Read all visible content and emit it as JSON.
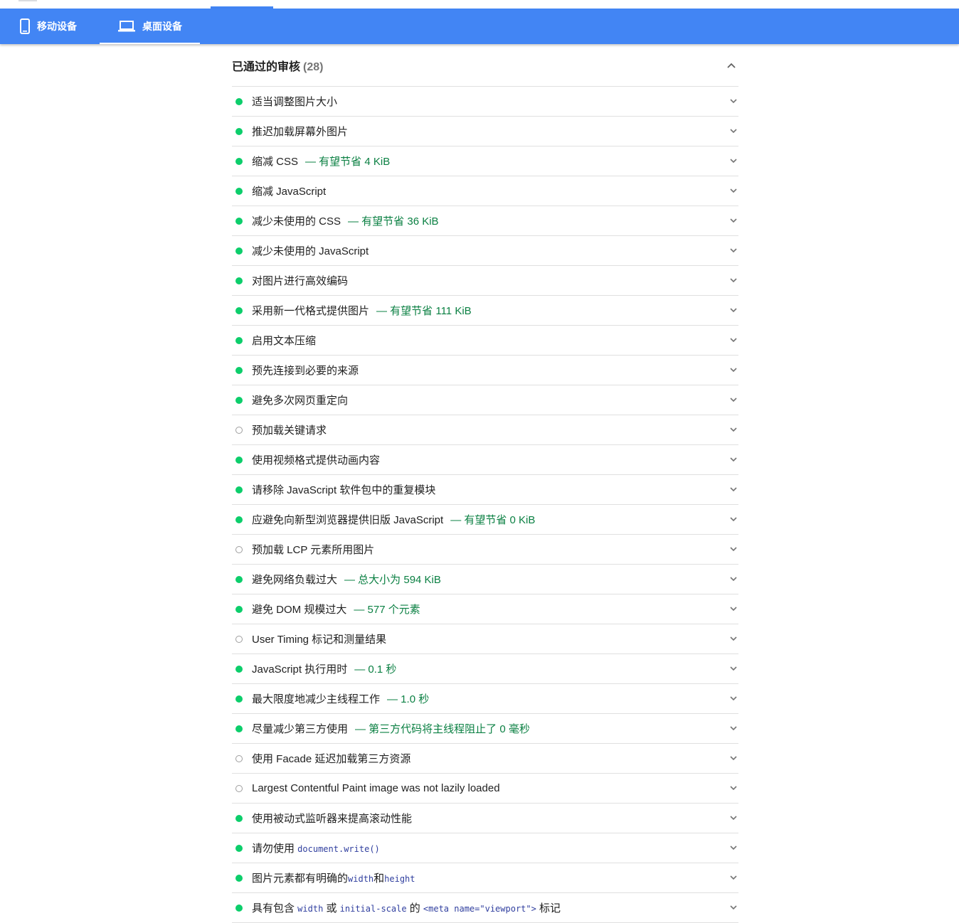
{
  "tabs": [
    {
      "label": "移动设备",
      "icon": "mobile-phone-icon"
    },
    {
      "label": "桌面设备",
      "icon": "laptop-icon",
      "active": true
    }
  ],
  "section": {
    "title": "已通过的审核",
    "count": "(28)"
  },
  "audits": [
    {
      "type": "pass",
      "title": "适当调整图片大小",
      "display": ""
    },
    {
      "type": "pass",
      "title": "推迟加载屏幕外图片",
      "display": ""
    },
    {
      "type": "pass",
      "title": "缩减 CSS",
      "display": "— 有望节省 4 KiB"
    },
    {
      "type": "pass",
      "title": "缩减 JavaScript",
      "display": ""
    },
    {
      "type": "pass",
      "title": "减少未使用的 CSS",
      "display": "— 有望节省 36 KiB"
    },
    {
      "type": "pass",
      "title": "减少未使用的 JavaScript",
      "display": ""
    },
    {
      "type": "pass",
      "title": "对图片进行高效编码",
      "display": ""
    },
    {
      "type": "pass",
      "title": "采用新一代格式提供图片",
      "display": "— 有望节省 111 KiB"
    },
    {
      "type": "pass",
      "title": "启用文本压缩",
      "display": ""
    },
    {
      "type": "pass",
      "title": "预先连接到必要的来源",
      "display": ""
    },
    {
      "type": "pass",
      "title": "避免多次网页重定向",
      "display": ""
    },
    {
      "type": "info",
      "title": "预加载关键请求",
      "display": ""
    },
    {
      "type": "pass",
      "title": "使用视频格式提供动画内容",
      "display": ""
    },
    {
      "type": "pass",
      "title": "请移除 JavaScript 软件包中的重复模块",
      "display": ""
    },
    {
      "type": "pass",
      "title": "应避免向新型浏览器提供旧版 JavaScript",
      "display": "— 有望节省 0 KiB"
    },
    {
      "type": "info",
      "title": "预加载 LCP 元素所用图片",
      "display": ""
    },
    {
      "type": "pass",
      "title": "避免网络负载过大",
      "display": "— 总大小为 594 KiB"
    },
    {
      "type": "pass",
      "title": "避免 DOM 规模过大",
      "display": "— 577 个元素"
    },
    {
      "type": "info",
      "title": "User Timing 标记和测量结果",
      "display": ""
    },
    {
      "type": "pass",
      "title": "JavaScript 执行用时",
      "display": "— 0.1 秒"
    },
    {
      "type": "pass",
      "title": "最大限度地减少主线程工作",
      "display": "— 1.0 秒"
    },
    {
      "type": "pass",
      "title": "尽量减少第三方使用",
      "display": "— 第三方代码将主线程阻止了 0 毫秒"
    },
    {
      "type": "info",
      "title": "使用 Facade 延迟加载第三方资源",
      "display": ""
    },
    {
      "type": "info",
      "title": "Largest Contentful Paint image was not lazily loaded",
      "display": ""
    },
    {
      "type": "pass",
      "title": "使用被动式监听器来提高滚动性能",
      "display": ""
    },
    {
      "type": "pass",
      "title_parts": [
        {
          "t": "请勿使用 "
        },
        {
          "c": "document.write()"
        }
      ],
      "title": "请勿使用 document.write()",
      "display": ""
    },
    {
      "type": "pass",
      "title_parts": [
        {
          "t": "图片元素都有明确的"
        },
        {
          "c": "width"
        },
        {
          "t": "和"
        },
        {
          "c": "height"
        }
      ],
      "title": "图片元素都有明确的width和height",
      "display": ""
    },
    {
      "type": "pass",
      "title_parts": [
        {
          "t": "具有包含 "
        },
        {
          "c": "width"
        },
        {
          "t": " 或 "
        },
        {
          "c": "initial-scale"
        },
        {
          "t": " 的 "
        },
        {
          "c": "<meta name=\"viewport\">"
        },
        {
          "t": " 标记"
        }
      ],
      "title": "具有包含 width 或 initial-scale 的 <meta name=\"viewport\"> 标记",
      "display": ""
    }
  ],
  "colors": {
    "tab_bar": "#4285f4",
    "pass": "#0cce6b",
    "display_text": "#0b8043"
  }
}
